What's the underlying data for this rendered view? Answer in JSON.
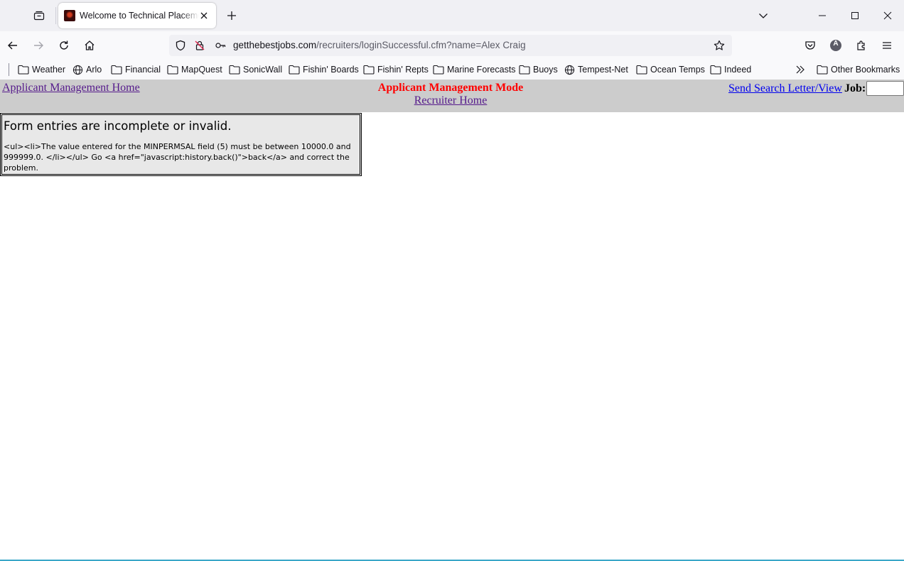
{
  "browser": {
    "tab": {
      "title": "Welcome to Technical Placeme"
    },
    "url": {
      "host": "getthebestjobs.com",
      "path": "/recruiters/loginSuccessful.cfm?name=Alex Craig"
    },
    "bookmarks": [
      {
        "label": "Weather",
        "icon": "folder-icon"
      },
      {
        "label": "Arlo",
        "icon": "globe-icon"
      },
      {
        "label": "Financial",
        "icon": "folder-icon"
      },
      {
        "label": "MapQuest",
        "icon": "folder-icon"
      },
      {
        "label": "SonicWall",
        "icon": "folder-icon"
      },
      {
        "label": "Fishin' Boards",
        "icon": "folder-icon"
      },
      {
        "label": "Fishin' Repts",
        "icon": "folder-icon"
      },
      {
        "label": "Marine Forecasts",
        "icon": "folder-icon"
      },
      {
        "label": "Buoys",
        "icon": "folder-icon"
      },
      {
        "label": "Tempest-Net",
        "icon": "globe-icon"
      },
      {
        "label": "Ocean Temps",
        "icon": "folder-icon"
      },
      {
        "label": "Indeed",
        "icon": "folder-icon"
      }
    ],
    "other_bookmarks": "Other Bookmarks",
    "profile_initial": "A"
  },
  "app": {
    "home_link": "Applicant Management Home",
    "mode_title": "Applicant Management Mode",
    "recruiter_home": "Recruiter Home",
    "send_link": "Send Search Letter/View",
    "job_label": "Job:",
    "job_value": ""
  },
  "error": {
    "title": "Form entries are incomplete or invalid.",
    "message": "<ul><li>The value entered for the MINPERMSAL field (5) must be between 10000.0 and 999999.0. </li></ul> Go <a href=\"javascript:history.back()\">back</a> and correct the problem."
  },
  "colors": {
    "header_bg": "#cccccc",
    "mode_title": "#ff0000",
    "visited_link": "#551a8b",
    "link": "#0000ee",
    "error_bg": "#e8e8e8"
  }
}
